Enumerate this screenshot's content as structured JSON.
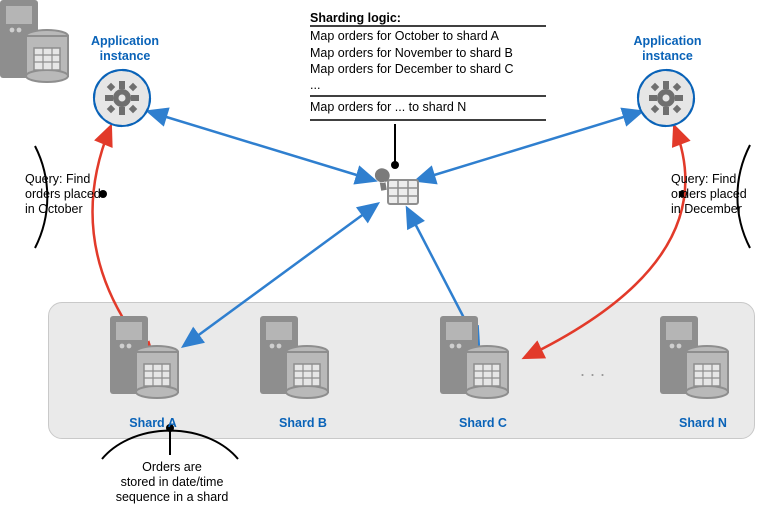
{
  "title_left": "Application instance",
  "title_right": "Application instance",
  "sharding_title": "Sharding logic:",
  "sharding_rules": [
    "Map orders for October to shard A",
    "Map orders for November to shard B",
    "Map orders for December to shard C"
  ],
  "sharding_ellipsis": "...",
  "sharding_last": "Map orders for ... to shard N",
  "query_left_line1": "Query: Find",
  "query_left_line2": "orders placed",
  "query_left_line3": "in October",
  "query_right_line1": "Query: Find",
  "query_right_line2": "orders placed",
  "query_right_line3": "in December",
  "shards": {
    "a": "Shard A",
    "b": "Shard B",
    "c": "Shard C",
    "n": "Shard N"
  },
  "shard_ellipsis": ". . .",
  "note_line1": "Orders are",
  "note_line2": "stored in date/time",
  "note_line3": "sequence in a shard",
  "chart_data": {
    "type": "diagram",
    "description": "Range-based sharding architecture diagram showing application instances routing queries by month to specific shards via sharding logic.",
    "mapping": [
      {
        "key": "October",
        "shard": "A"
      },
      {
        "key": "November",
        "shard": "B"
      },
      {
        "key": "December",
        "shard": "C"
      },
      {
        "key": "...",
        "shard": "N"
      }
    ],
    "queries": [
      {
        "source": "Application instance (left)",
        "criteria": "orders placed in October",
        "resolved_shard": "Shard A"
      },
      {
        "source": "Application instance (right)",
        "criteria": "orders placed in December",
        "resolved_shard": "Shard C"
      }
    ],
    "shards": [
      "Shard A",
      "Shard B",
      "Shard C",
      "Shard N"
    ],
    "note": "Orders are stored in date/time sequence in a shard"
  }
}
